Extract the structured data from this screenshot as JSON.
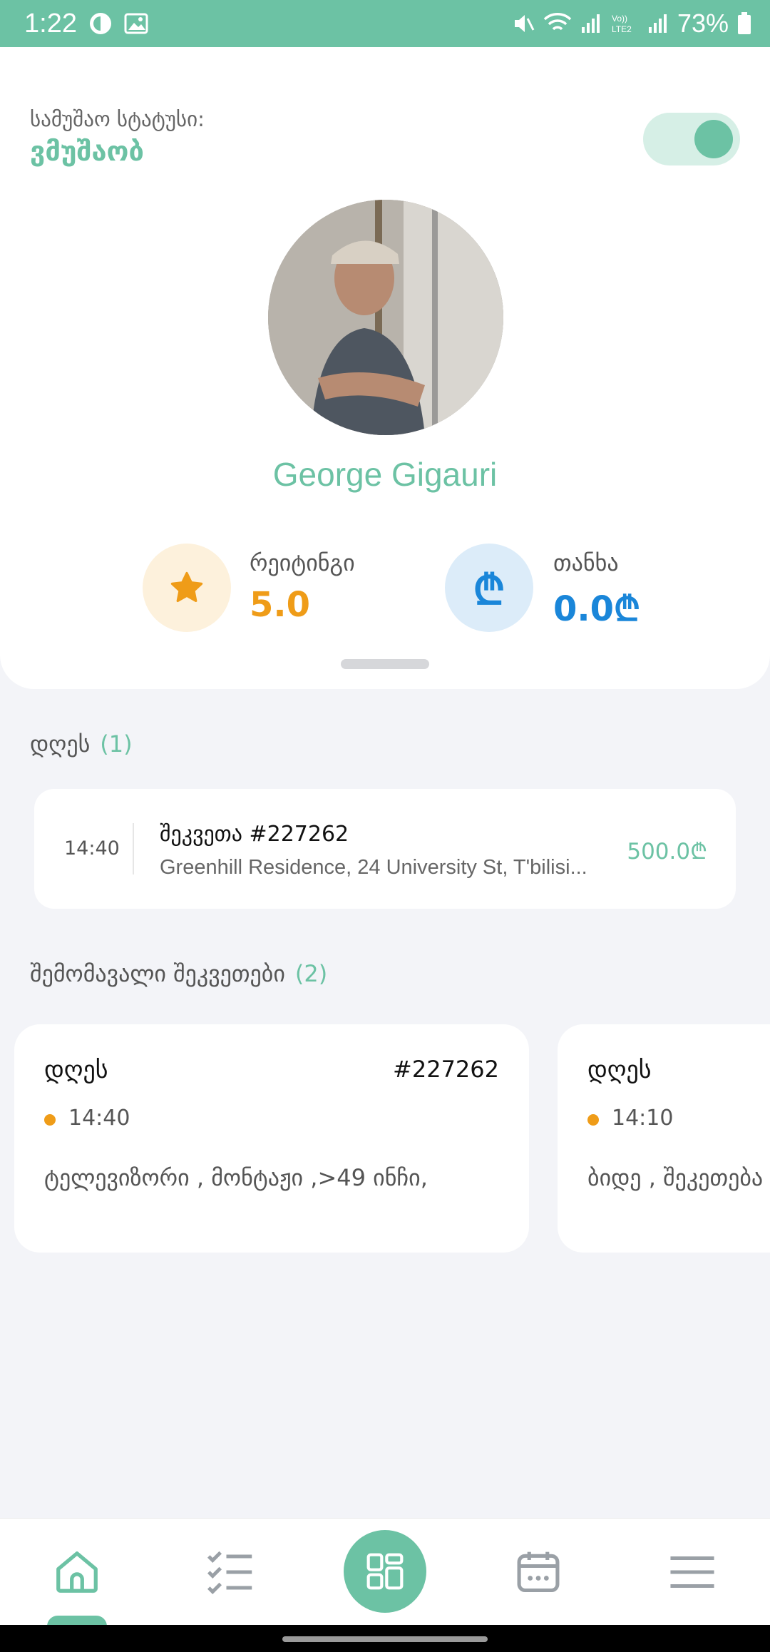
{
  "status_bar": {
    "time": "1:22",
    "battery": "73%"
  },
  "header": {
    "work_status_label": "სამუშაო სტატუსი:",
    "work_status_value": "ვმუშაობ",
    "toggle_on": true
  },
  "profile": {
    "name": "George Gigauri",
    "rating_label": "რეიტინგი",
    "rating_value": "5.0",
    "balance_label": "თანხა",
    "balance_value": "0.0₾",
    "balance_icon_glyph": "₾"
  },
  "today": {
    "title": "დღეს",
    "count": "(1)",
    "order": {
      "time": "14:40",
      "title": "შეკვეთა #227262",
      "address": "Greenhill Residence, 24 University St, T'bilisi...",
      "price": "500.0₾"
    }
  },
  "upcoming": {
    "title": "შემომავალი შეკვეთები",
    "count": "(2)",
    "cards": [
      {
        "day": "დღეს",
        "number": "#227262",
        "time": "14:40",
        "description": "ტელევიზორი , მონტაჟი ,>49 ინჩი,"
      },
      {
        "day": "დღეს",
        "number": "",
        "time": "14:10",
        "description": "ბიდე , შეკეთება"
      }
    ]
  },
  "nav": {
    "items": [
      "home-icon",
      "tasks-icon",
      "dashboard-icon",
      "calendar-icon",
      "menu-icon"
    ],
    "active": "home-icon"
  },
  "colors": {
    "accent": "#6cc2a4",
    "rating": "#ef9c18",
    "balance": "#1a86d9"
  }
}
